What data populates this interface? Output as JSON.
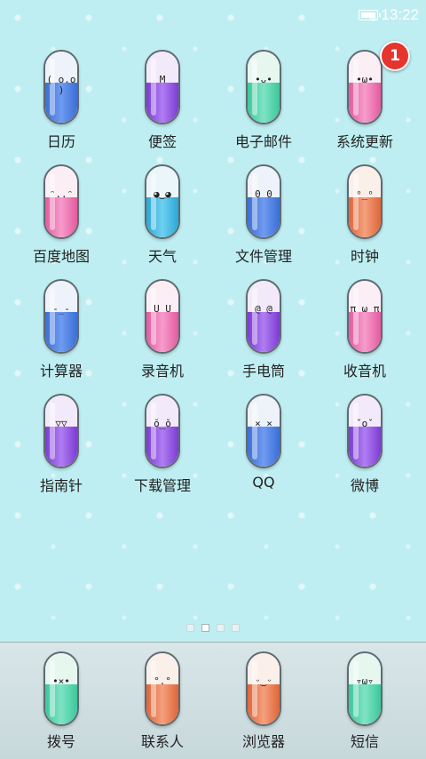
{
  "status_bar": {
    "time": "13:22"
  },
  "apps": [
    {
      "label": "日历",
      "face": "( o.o )",
      "color": "blue"
    },
    {
      "label": "便签",
      "face": "M",
      "color": "purple"
    },
    {
      "label": "电子邮件",
      "face": "•ᴗ•",
      "color": "green"
    },
    {
      "label": "系统更新",
      "face": "•ω•",
      "color": "pink",
      "badge": "1"
    },
    {
      "label": "百度地图",
      "face": "ᵔ..ᵔ",
      "color": "pink"
    },
    {
      "label": "天气",
      "face": "◕‿◕",
      "color": "cyan"
    },
    {
      "label": "文件管理",
      "face": "0 0",
      "color": "blue"
    },
    {
      "label": "时钟",
      "face": "ᵒ_ᵒ",
      "color": "orange"
    },
    {
      "label": "计算器",
      "face": "-_-",
      "color": "blue"
    },
    {
      "label": "录音机",
      "face": "U U",
      "color": "pink"
    },
    {
      "label": "手电筒",
      "face": "@ @",
      "color": "purple"
    },
    {
      "label": "收音机",
      "face": "π ω π",
      "color": "pink"
    },
    {
      "label": "指南针",
      "face": "▽▽",
      "color": "purple"
    },
    {
      "label": "下载管理",
      "face": "ŏ_ŏ",
      "color": "purple"
    },
    {
      "label": "QQ",
      "face": "× ×",
      "color": "blue"
    },
    {
      "label": "微博",
      "face": "ˇoˇ",
      "color": "purple"
    }
  ],
  "page_indicator": {
    "count": 4,
    "active": 1
  },
  "dock": [
    {
      "label": "拨号",
      "face": "•×•",
      "color": "green"
    },
    {
      "label": "联系人",
      "face": "°.°",
      "color": "orange"
    },
    {
      "label": "浏览器",
      "face": "ᵕ‿ᵕ",
      "color": "orange"
    },
    {
      "label": "短信",
      "face": "▿ω▿",
      "color": "green"
    }
  ]
}
